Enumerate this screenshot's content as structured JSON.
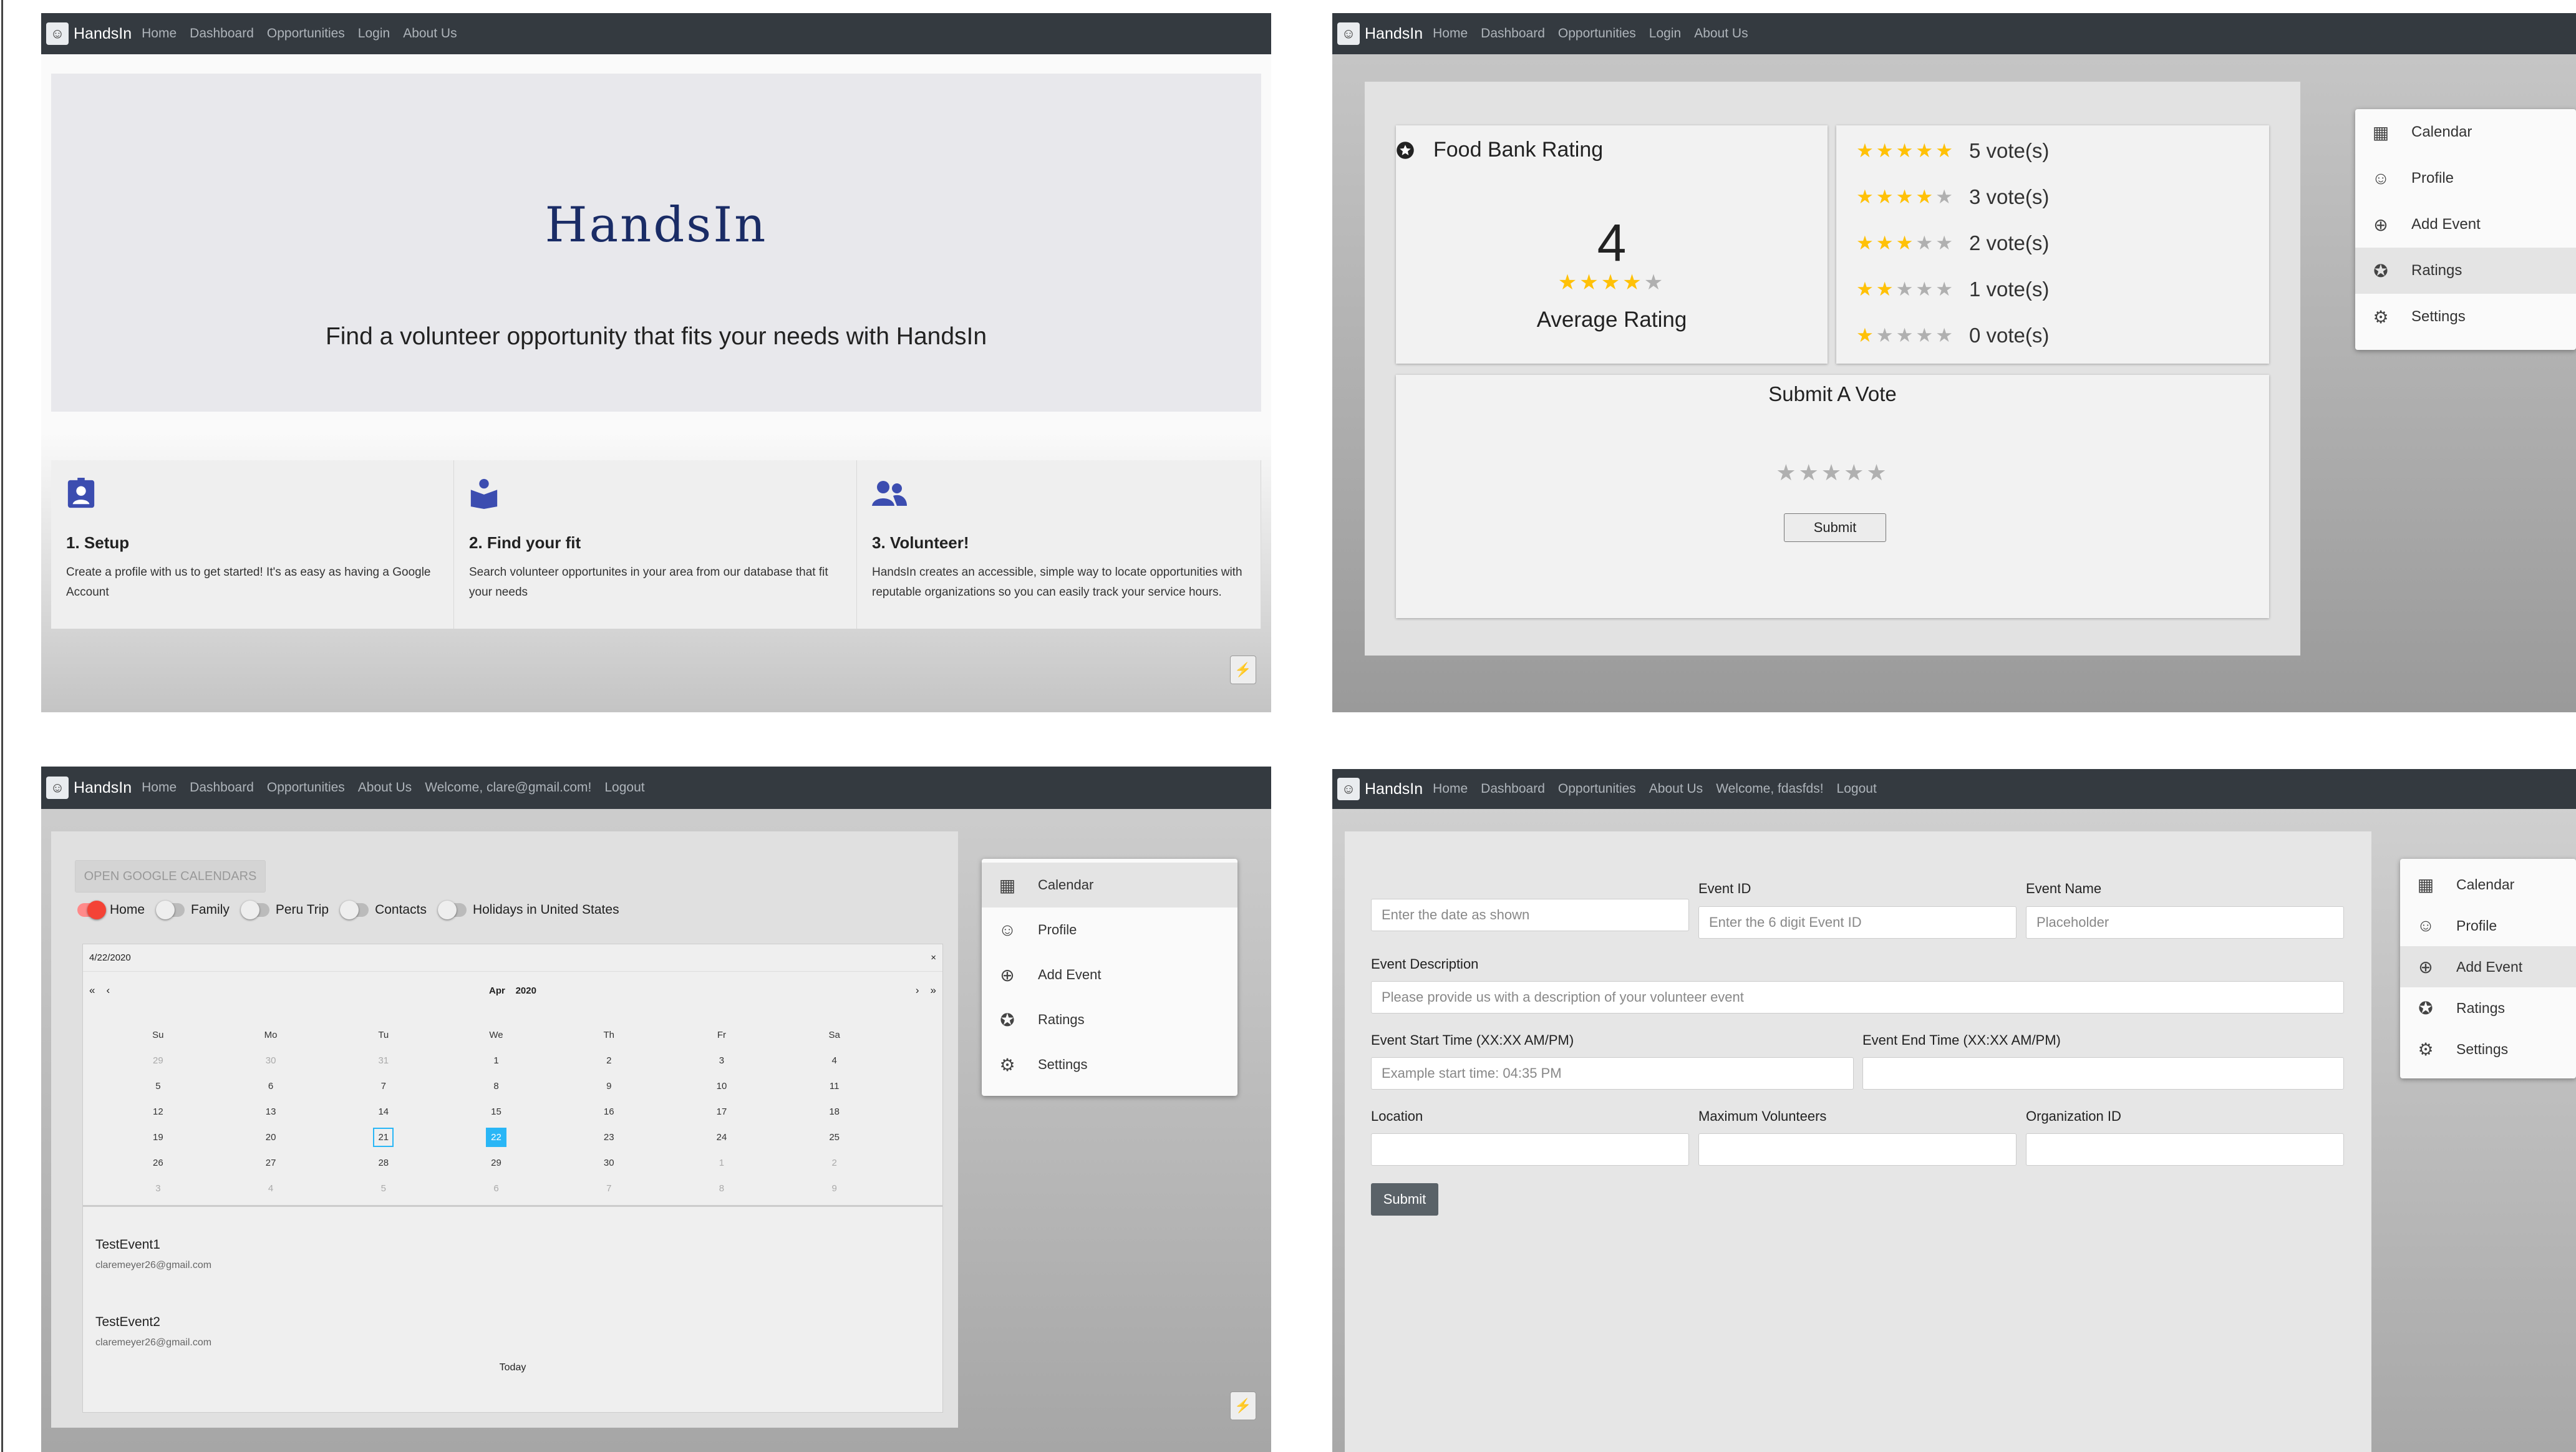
{
  "panel1": {
    "nav": {
      "brand": "HandsIn",
      "links": [
        "Home",
        "Dashboard",
        "Opportunities",
        "Login",
        "About Us"
      ]
    },
    "hero": {
      "title": "HandsIn",
      "subtitle": "Find a volunteer opportunity that fits your needs with HandsIn"
    },
    "features": [
      {
        "icon": "profile-badge-icon",
        "title": "1. Setup",
        "text": "Create a profile with us to get started! It's as easy as having a Google Account"
      },
      {
        "icon": "book-reader-icon",
        "title": "2. Find your fit",
        "text": "Search volunteer opportunites in your area from our database that fit your needs"
      },
      {
        "icon": "users-icon",
        "title": "3. Volunteer!",
        "text": "HandsIn creates an accessible, simple way to locate opportunities with reputable organizations so you can easily track your service hours."
      }
    ]
  },
  "panel2": {
    "nav": {
      "brand": "HandsIn",
      "links": [
        "Home",
        "Dashboard",
        "Opportunities",
        "Login",
        "About Us"
      ]
    },
    "rating": {
      "title": "Food Bank Rating",
      "average": "4",
      "average_stars": 4,
      "average_label": "Average Rating"
    },
    "votes": [
      {
        "stars": 5,
        "label": "5 vote(s)"
      },
      {
        "stars": 4,
        "label": "3 vote(s)"
      },
      {
        "stars": 3,
        "label": "2 vote(s)"
      },
      {
        "stars": 2,
        "label": "1 vote(s)"
      },
      {
        "stars": 1,
        "label": "0 vote(s)"
      }
    ],
    "submit_vote": {
      "title": "Submit A Vote",
      "selected_stars": 0,
      "button": "Submit"
    },
    "menu": {
      "items": [
        "Calendar",
        "Profile",
        "Add Event",
        "Ratings",
        "Settings"
      ],
      "active": "Ratings"
    }
  },
  "panel3": {
    "nav": {
      "brand": "HandsIn",
      "links": [
        "Home",
        "Dashboard",
        "Opportunities",
        "About Us",
        "Welcome, clare@gmail.com!",
        "Logout"
      ]
    },
    "calendar": {
      "open_button": "OPEN GOOGLE CALENDARS",
      "toggles": [
        {
          "label": "Home",
          "on": true
        },
        {
          "label": "Family",
          "on": false
        },
        {
          "label": "Peru Trip",
          "on": false
        },
        {
          "label": "Contacts",
          "on": false
        },
        {
          "label": "Holidays in United States",
          "on": false
        }
      ],
      "date_input": "4/22/2020",
      "clear": "×",
      "nav_prev2": "«",
      "nav_prev": "‹",
      "nav_next": "›",
      "nav_next2": "»",
      "month": "Apr",
      "year": "2020",
      "weekdays": [
        "Su",
        "Mo",
        "Tu",
        "We",
        "Th",
        "Fr",
        "Sa"
      ],
      "weeks": [
        [
          "29",
          "30",
          "31",
          "1",
          "2",
          "3",
          "4"
        ],
        [
          "5",
          "6",
          "7",
          "8",
          "9",
          "10",
          "11"
        ],
        [
          "12",
          "13",
          "14",
          "15",
          "16",
          "17",
          "18"
        ],
        [
          "19",
          "20",
          "21",
          "22",
          "23",
          "24",
          "25"
        ],
        [
          "26",
          "27",
          "28",
          "29",
          "30",
          "1",
          "2"
        ],
        [
          "3",
          "4",
          "5",
          "6",
          "7",
          "8",
          "9"
        ]
      ],
      "today": "21",
      "selected": "22",
      "events": [
        {
          "title": "TestEvent1",
          "email": "claremeyer26@gmail.com"
        },
        {
          "title": "TestEvent2",
          "email": "claremeyer26@gmail.com"
        }
      ],
      "today_button": "Today"
    },
    "menu": {
      "items": [
        "Calendar",
        "Profile",
        "Add Event",
        "Ratings",
        "Settings"
      ],
      "active": "Calendar"
    }
  },
  "panel4": {
    "nav": {
      "brand": "HandsIn",
      "links": [
        "Home",
        "Dashboard",
        "Opportunities",
        "About Us",
        "Welcome, fdasfds!",
        "Logout"
      ]
    },
    "form": {
      "date": {
        "label": "",
        "placeholder": "Enter the date as shown"
      },
      "event_id": {
        "label": "Event ID",
        "placeholder": "Enter the 6 digit Event ID"
      },
      "event_name": {
        "label": "Event Name",
        "placeholder": "Placeholder"
      },
      "description": {
        "label": "Event Description",
        "placeholder": "Please provide us with a description of your volunteer event"
      },
      "start_time": {
        "label": "Event Start Time (XX:XX AM/PM)",
        "placeholder": "Example start time: 04:35 PM"
      },
      "end_time": {
        "label": "Event End Time (XX:XX AM/PM)",
        "placeholder": ""
      },
      "location": {
        "label": "Location",
        "placeholder": ""
      },
      "max_volunteers": {
        "label": "Maximum Volunteers",
        "placeholder": ""
      },
      "org_id": {
        "label": "Organization ID",
        "placeholder": ""
      },
      "submit": "Submit"
    },
    "menu": {
      "items": [
        "Calendar",
        "Profile",
        "Add Event",
        "Ratings",
        "Settings"
      ],
      "active": "Add Event"
    }
  },
  "icons": {
    "bolt": "⚡",
    "cursor": "➤"
  },
  "colors": {
    "navbar": "#343a40",
    "star": "#ffc107",
    "accent": "#3c4db0",
    "toggle_on": "#f44336",
    "selected_day": "#29b6f6"
  }
}
